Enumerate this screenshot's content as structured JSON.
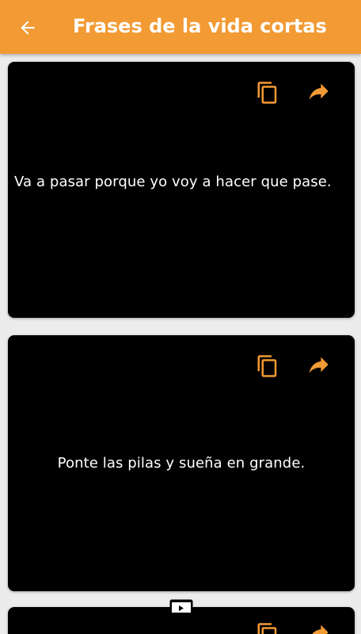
{
  "header": {
    "title": "Frases de la vida cortas",
    "back_icon": "arrow-left-icon",
    "background_color": "#f29a33"
  },
  "cards": [
    {
      "text": "Va a pasar porque yo voy a hacer que pase.",
      "copy_icon": "copy-icon",
      "share_icon": "share-icon"
    },
    {
      "text": "Ponte las pilas y sueña en grande.",
      "copy_icon": "copy-icon",
      "share_icon": "share-icon"
    },
    {
      "text": "",
      "copy_icon": "copy-icon",
      "share_icon": "share-icon"
    }
  ],
  "colors": {
    "accent": "#f29a33",
    "card_bg": "#000000",
    "text": "#ffffff",
    "page_bg": "#ececec"
  }
}
